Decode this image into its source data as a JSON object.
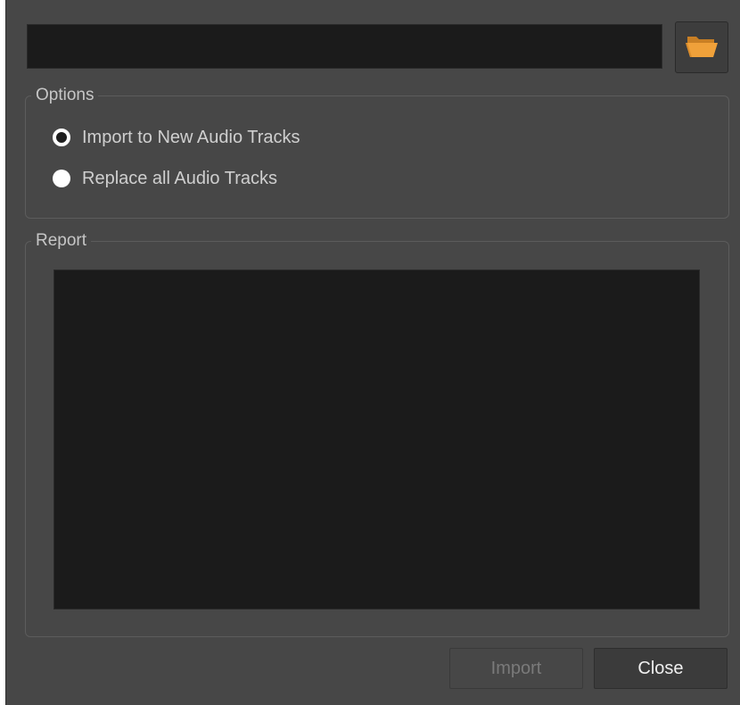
{
  "path_field": {
    "value": ""
  },
  "browse_button": {
    "icon": "folder-open-icon",
    "icon_color": "#f0a13a"
  },
  "options": {
    "title": "Options",
    "radios": [
      {
        "label": "Import to New Audio Tracks",
        "selected": true
      },
      {
        "label": "Replace all Audio Tracks",
        "selected": false
      }
    ]
  },
  "report": {
    "title": "Report",
    "content": ""
  },
  "buttons": {
    "import_label": "Import",
    "import_enabled": false,
    "close_label": "Close"
  },
  "colors": {
    "dialog_bg": "#474747",
    "field_bg": "#1b1b1b",
    "accent": "#f0a13a"
  }
}
